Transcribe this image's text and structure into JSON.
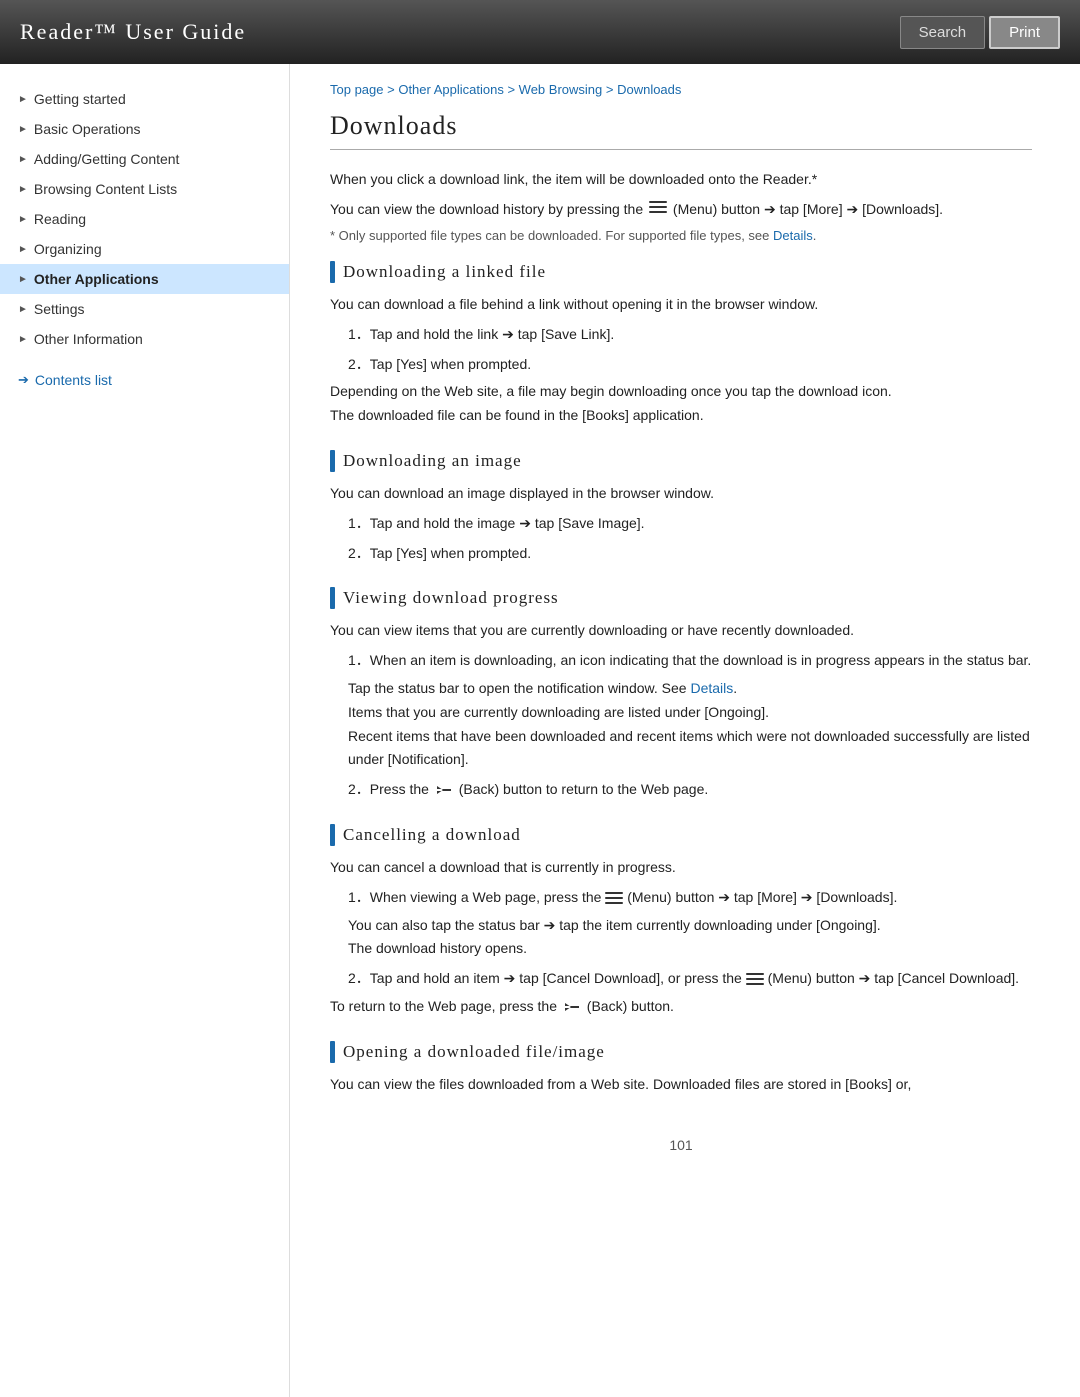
{
  "header": {
    "title": "Reader™ User Guide",
    "search_label": "Search",
    "print_label": "Print"
  },
  "breadcrumb": {
    "items": [
      "Top page",
      "Other Applications",
      "Web Browsing",
      "Downloads"
    ]
  },
  "sidebar": {
    "items": [
      {
        "label": "Getting started",
        "active": false
      },
      {
        "label": "Basic Operations",
        "active": false
      },
      {
        "label": "Adding/Getting Content",
        "active": false
      },
      {
        "label": "Browsing Content Lists",
        "active": false
      },
      {
        "label": "Reading",
        "active": false
      },
      {
        "label": "Organizing",
        "active": false
      },
      {
        "label": "Other Applications",
        "active": true
      },
      {
        "label": "Settings",
        "active": false
      },
      {
        "label": "Other Information",
        "active": false
      }
    ],
    "contents_link": "Contents list"
  },
  "page": {
    "title": "Downloads",
    "intro": {
      "line1": "When you click a download link, the item will be downloaded onto the Reader.*",
      "line2_pre": "You can view the download history by pressing the",
      "line2_menu": "(Menu) button",
      "line2_arrow1": "→",
      "line2_tap": "tap [More]",
      "line2_arrow2": "→",
      "line2_post": "[Downloads].",
      "note": "* Only supported file types can be downloaded. For supported file types, see",
      "note_link": "Details",
      "note_end": "."
    },
    "sections": [
      {
        "id": "downloading-linked-file",
        "title": "Downloading a linked file",
        "body": "You can download a file behind a link without opening it in the browser window.",
        "steps": [
          {
            "num": "1",
            "text_pre": "Tap and hold the link",
            "arrow": "→",
            "text_post": "tap [Save Link]."
          },
          {
            "num": "2",
            "text": "Tap [Yes] when prompted."
          }
        ],
        "extra": [
          "Depending on the Web site, a file may begin downloading once you tap the download icon.",
          "The downloaded file can be found in the [Books] application."
        ]
      },
      {
        "id": "downloading-an-image",
        "title": "Downloading an image",
        "body": "You can download an image displayed in the browser window.",
        "steps": [
          {
            "num": "1",
            "text_pre": "Tap and hold the image",
            "arrow": "→",
            "text_post": "tap [Save Image]."
          },
          {
            "num": "2",
            "text": "Tap [Yes] when prompted."
          }
        ],
        "extra": []
      },
      {
        "id": "viewing-download-progress",
        "title": "Viewing download progress",
        "body": "You can view items that you are currently downloading or have recently downloaded.",
        "steps": [
          {
            "num": "1",
            "text": "When an item is downloading, an icon indicating that the download is in progress appears in the status bar."
          }
        ],
        "sub_steps": [
          {
            "text_pre": "Tap the status bar to open the notification window. See",
            "link": "Details",
            "text_post": "."
          },
          {
            "text": "Items that you are currently downloading are listed under [Ongoing]."
          },
          {
            "text": "Recent items that have been downloaded and recent items which were not downloaded successfully are listed under [Notification]."
          }
        ],
        "step2": {
          "num": "2",
          "text_pre": "Press the",
          "back": "(Back) button to return to the Web page.",
          "back_icon": true
        }
      },
      {
        "id": "cancelling-a-download",
        "title": "Cancelling a download",
        "body": "You can cancel a download that is currently in progress.",
        "steps": [
          {
            "num": "1",
            "text_pre": "When viewing a Web page, press the",
            "menu": "(Menu) button",
            "arrow1": "→",
            "tap": "tap [More]",
            "arrow2": "→",
            "text_post": "[Downloads]."
          }
        ],
        "sub_steps2": [
          {
            "text_pre": "You can also tap the status bar",
            "arrow": "→",
            "text_post": "tap the item currently downloading under [Ongoing]."
          },
          {
            "text": "The download history opens."
          }
        ],
        "step2_cancel": {
          "num": "2",
          "text_pre": "Tap and hold an item",
          "arrow1": "→",
          "text_mid": "tap [Cancel Download], or press the",
          "menu": "(Menu) button",
          "arrow2": "→",
          "text_post": "tap [Cancel Download]."
        },
        "return_text_pre": "To return to the Web page, press the",
        "return_text_post": "(Back) button.",
        "back_icon": true
      },
      {
        "id": "opening-a-downloaded-file-image",
        "title": "Opening a downloaded file/image",
        "body": "You can view the files downloaded from a Web site. Downloaded files are stored in [Books] or,"
      }
    ],
    "page_number": "101"
  }
}
